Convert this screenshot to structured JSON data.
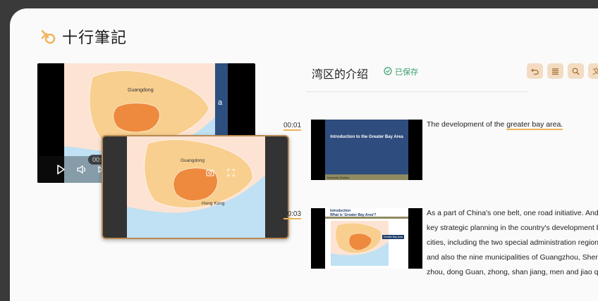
{
  "app": {
    "name": "十行筆記"
  },
  "player": {
    "time": "00:00 / 2:00",
    "map_labels": [
      "Guangdong"
    ],
    "blue_slide_letter": "a"
  },
  "mini_player": {
    "map_labels": [
      "Guangdong",
      "Hong Kong"
    ]
  },
  "note": {
    "title": "湾区的介绍",
    "saved_label": "已保存"
  },
  "toolbar": {
    "icons": [
      "undo-icon",
      "list-icon",
      "search-icon",
      "translate-icon"
    ],
    "translate_glyph": "文"
  },
  "entries": [
    {
      "timestamp": "00:01",
      "slide_title": "Introduction to the Greater Bay Area",
      "slide_footer": "Domestic Studies",
      "text_before": "The development of the ",
      "text_highlight": "greater bay area.",
      "lines": []
    },
    {
      "timestamp": "00:03",
      "slide_title_line1": "Introduction",
      "slide_title_line2": "What is 'Greater Bay Area'?",
      "slide_tag": "Greater Bay Area",
      "lines": [
        "As a part of China's one belt, one road initiative. And it",
        "key strategic planning in the country's development blu",
        "cities, including the two special administration regions",
        "and also the nine municipalities of Guangzhou, Shenzh",
        "zhou, dong Guan, zhong, shan jiang, men and jiao qin"
      ]
    }
  ],
  "colors": {
    "accent": "#f0b45b",
    "saved_green": "#3aa06b",
    "tool_bg": "#f3dcc2",
    "slide_blue": "#2e4c7d"
  }
}
